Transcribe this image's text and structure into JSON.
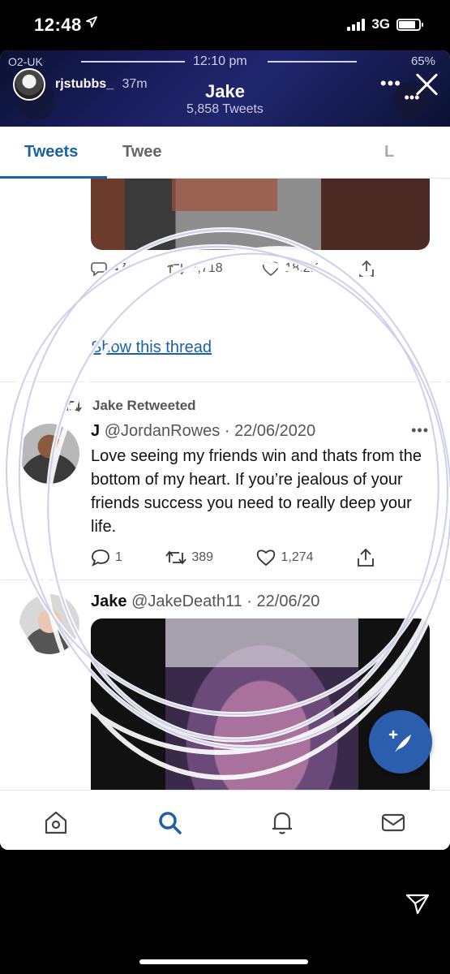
{
  "ios_status": {
    "time": "12:48",
    "network": "3G"
  },
  "inner_status": {
    "carrier": "O2-UK",
    "time": "12:10 pm",
    "battery": "65%"
  },
  "story": {
    "username": "rjstubbs_",
    "posted_ago": "37m"
  },
  "profile": {
    "name": "Jake",
    "tweet_count": "5,858 Tweets"
  },
  "tabs": [
    {
      "label": "Tweets"
    },
    {
      "label": "Twee"
    },
    {
      "label": "L"
    }
  ],
  "thread_actions": {
    "replies": "47",
    "retweets": "2,718",
    "likes": "18.2K"
  },
  "show_thread_label": "Show this thread",
  "retweet_tweet": {
    "retweeted_label": "Jake Retweeted",
    "name": "J",
    "handle": "@JordanRowes",
    "date": "22/06/2020",
    "text": "Love seeing my friends win and thats from the bottom of my heart. If you’re jealous of your friends success you need to really deep your life.",
    "replies": "1",
    "retweets": "389",
    "likes": "1,274"
  },
  "jake_tweet": {
    "name": "Jake",
    "handle": "@JakeDeath11",
    "date": "22/06/20"
  },
  "colors": {
    "accent": "#1b61a8",
    "fab": "#2b5fae",
    "banner": "#1b1e60"
  },
  "bottom_nav": [
    "home-icon",
    "search-icon",
    "bell-icon",
    "mail-icon"
  ]
}
